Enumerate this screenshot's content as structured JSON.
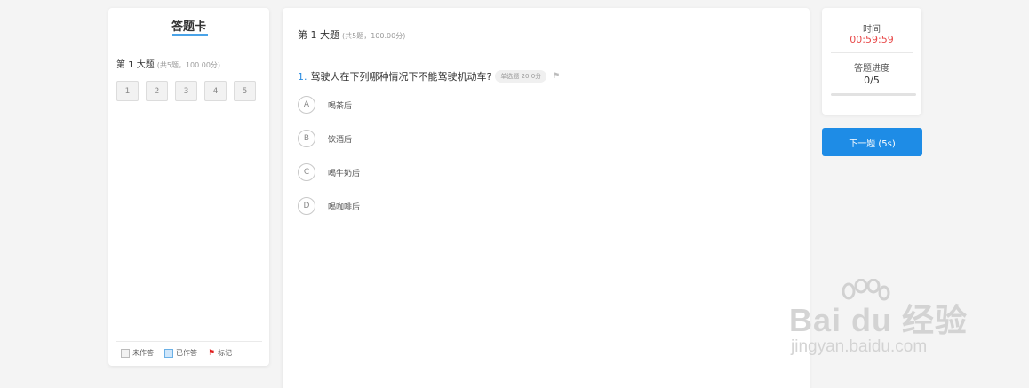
{
  "answer_card": {
    "title": "答题卡",
    "section_title": "第 1 大题",
    "section_sub": "(共5题，100.00分)",
    "question_numbers": [
      "1",
      "2",
      "3",
      "4",
      "5"
    ],
    "legend": {
      "unanswered": "未作答",
      "answered": "已作答",
      "marked": "标记"
    }
  },
  "main": {
    "section_title": "第 1 大题",
    "section_sub": "(共5题，100.00分)",
    "question": {
      "number": "1.",
      "text": "驾驶人在下列哪种情况下不能驾驶机动车?",
      "tag": "单选题 20.0分",
      "options": [
        {
          "letter": "A",
          "text": "喝茶后"
        },
        {
          "letter": "B",
          "text": "饮酒后"
        },
        {
          "letter": "C",
          "text": "喝牛奶后"
        },
        {
          "letter": "D",
          "text": "喝咖啡后"
        }
      ]
    }
  },
  "sidebar": {
    "time_label": "时间",
    "time_value": "00:59:59",
    "progress_label": "答题进度",
    "progress_value": "0/5",
    "progress_fraction": 0,
    "next_button": "下一题 (5s)"
  },
  "watermark": {
    "brand": "Bai du 经验",
    "url": "jingyan.baidu.com"
  },
  "colors": {
    "accent": "#1e8ce6",
    "timer": "#e84a4a",
    "background": "#f4f4f4"
  }
}
